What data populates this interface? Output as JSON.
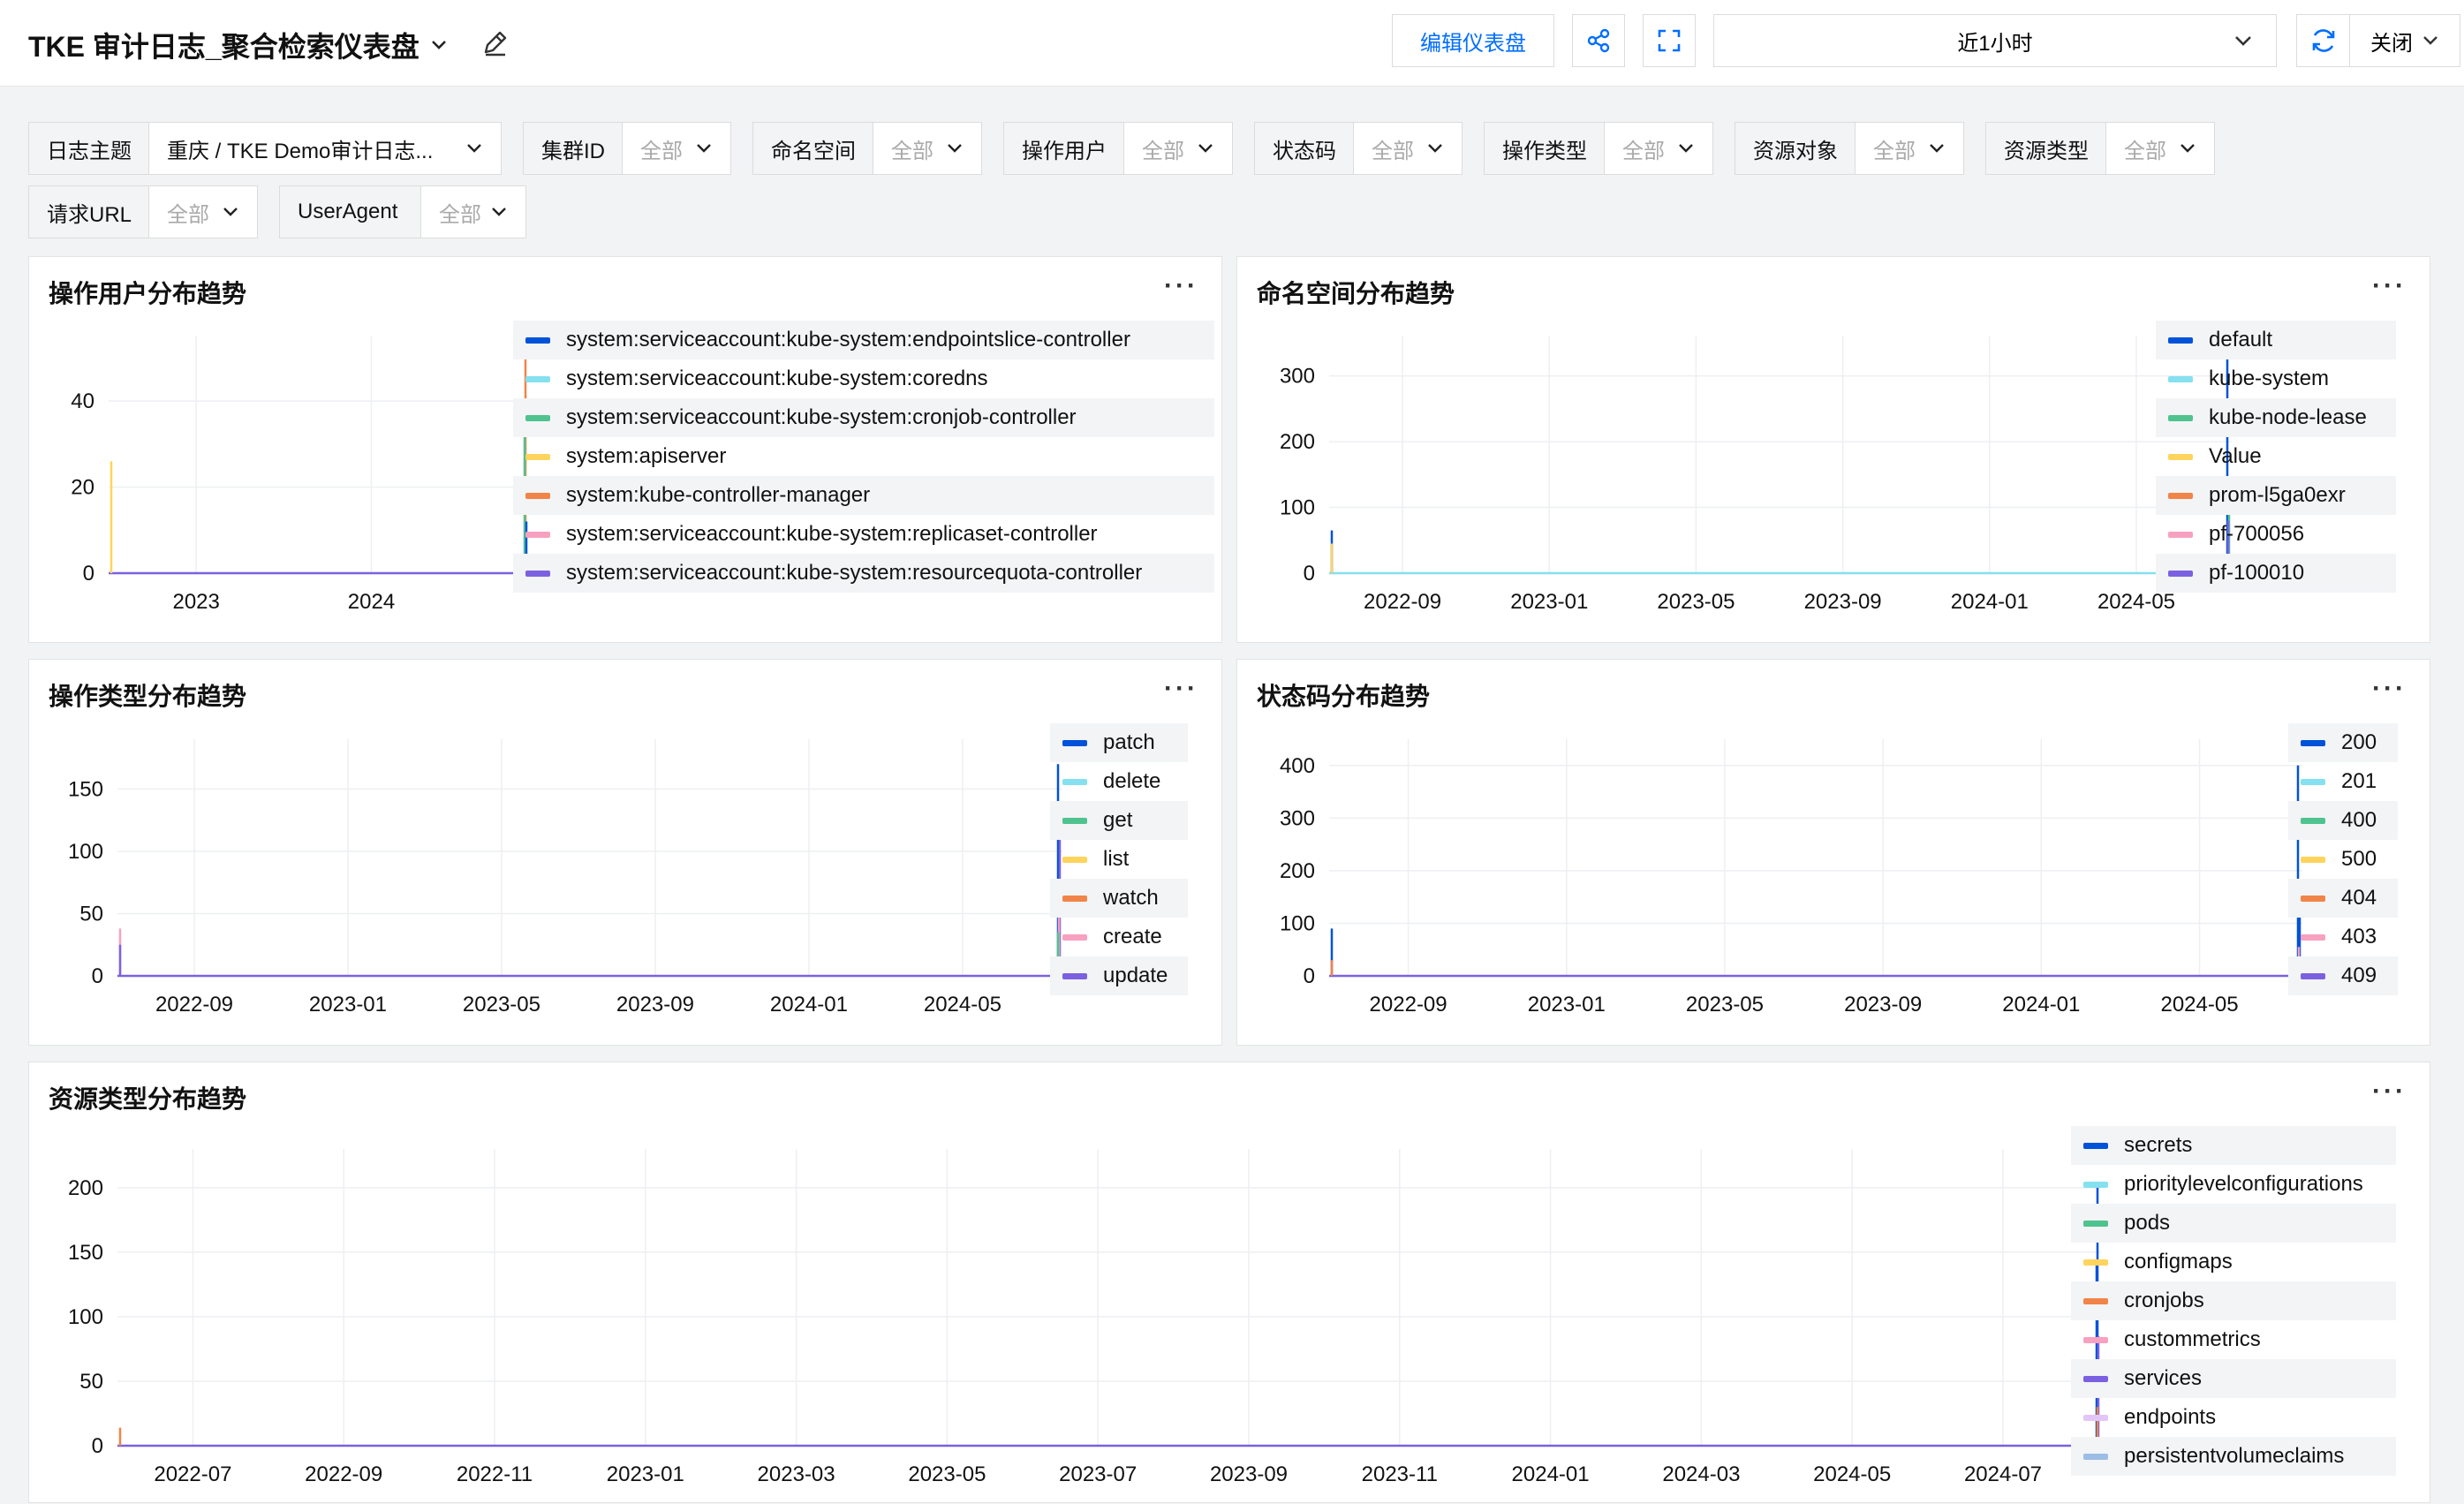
{
  "header": {
    "title": "TKE 审计日志_聚合检索仪表盘",
    "edit_button": "编辑仪表盘",
    "time_range": "近1小时",
    "close_label": "关闭"
  },
  "filters": [
    {
      "label": "日志主题",
      "value": "重庆 / TKE Demo审计日志..."
    },
    {
      "label": "集群ID",
      "value": "全部"
    },
    {
      "label": "命名空间",
      "value": "全部"
    },
    {
      "label": "操作用户",
      "value": "全部"
    },
    {
      "label": "状态码",
      "value": "全部"
    },
    {
      "label": "操作类型",
      "value": "全部"
    },
    {
      "label": "资源对象",
      "value": "全部"
    },
    {
      "label": "资源类型",
      "value": "全部"
    },
    {
      "label": "请求URL",
      "value": "全部"
    },
    {
      "label": "UserAgent",
      "value": "全部"
    }
  ],
  "colors": [
    "#0052d9",
    "#85e0f0",
    "#4fc38f",
    "#ffd45c",
    "#f18448",
    "#f8a0c0",
    "#7b61e0",
    "#e3c6f7",
    "#9bbde6"
  ],
  "panels": [
    {
      "title": "操作用户分布趋势",
      "more": "···",
      "chart_data": {
        "type": "line",
        "x_ticks": [
          "2023",
          "2024"
        ],
        "y_ticks": [
          0,
          20,
          40
        ],
        "ylim": [
          0,
          55
        ],
        "legend": [
          "system:serviceaccount:kube-system:endpointslice-controller",
          "system:serviceaccount:kube-system:coredns",
          "system:serviceaccount:kube-system:cronjob-controller",
          "system:apiserver",
          "system:kube-controller-manager",
          "system:serviceaccount:kube-system:replicaset-controller",
          "system:serviceaccount:kube-system:resourcequota-controller"
        ],
        "spikes": [
          {
            "x": 0.0,
            "y": 26,
            "c": 3
          },
          {
            "x": 1.0,
            "y": 52,
            "c": 4
          },
          {
            "x": 1.0,
            "y": 32,
            "c": 2
          },
          {
            "x": 1.0,
            "y": 12,
            "c": 0
          }
        ]
      }
    },
    {
      "title": "命名空间分布趋势",
      "more": "···",
      "chart_data": {
        "type": "line",
        "x_ticks": [
          "2022-09",
          "2023-01",
          "2023-05",
          "2023-09",
          "2024-01",
          "2024-05"
        ],
        "y_ticks": [
          0,
          100,
          200,
          300
        ],
        "ylim": [
          0,
          360
        ],
        "legend": [
          "default",
          "kube-system",
          "kube-node-lease",
          "Value",
          "prom-l5ga0exr",
          "pf-700056",
          "pf-100010"
        ],
        "spikes": [
          {
            "x": 0.0,
            "y": 65,
            "c": 0
          },
          {
            "x": 0.0,
            "y": 45,
            "c": 3
          },
          {
            "x": 1.0,
            "y": 325,
            "c": 0
          },
          {
            "x": 1.0,
            "y": 145,
            "c": 2
          },
          {
            "x": 1.0,
            "y": 80,
            "c": 6
          }
        ]
      }
    },
    {
      "title": "操作类型分布趋势",
      "more": "···",
      "chart_data": {
        "type": "line",
        "x_ticks": [
          "2022-09",
          "2023-01",
          "2023-05",
          "2023-09",
          "2024-01",
          "2024-05"
        ],
        "y_ticks": [
          0,
          50,
          100,
          150
        ],
        "ylim": [
          0,
          190
        ],
        "legend": [
          "patch",
          "delete",
          "get",
          "list",
          "watch",
          "create",
          "update"
        ],
        "spikes": [
          {
            "x": 0.0,
            "y": 38,
            "c": 5
          },
          {
            "x": 0.0,
            "y": 25,
            "c": 6
          },
          {
            "x": 1.0,
            "y": 170,
            "c": 0
          },
          {
            "x": 1.0,
            "y": 140,
            "c": 6
          },
          {
            "x": 1.0,
            "y": 75,
            "c": 5
          },
          {
            "x": 1.0,
            "y": 35,
            "c": 2
          }
        ]
      }
    },
    {
      "title": "状态码分布趋势",
      "more": "···",
      "chart_data": {
        "type": "line",
        "x_ticks": [
          "2022-09",
          "2023-01",
          "2023-05",
          "2023-09",
          "2024-01",
          "2024-05"
        ],
        "y_ticks": [
          0,
          100,
          200,
          300,
          400
        ],
        "ylim": [
          0,
          450
        ],
        "legend": [
          "200",
          "201",
          "400",
          "500",
          "404",
          "403",
          "409"
        ],
        "spikes": [
          {
            "x": 0.0,
            "y": 90,
            "c": 0
          },
          {
            "x": 0.0,
            "y": 30,
            "c": 4
          },
          {
            "x": 1.0,
            "y": 400,
            "c": 0
          },
          {
            "x": 1.0,
            "y": 145,
            "c": 0
          },
          {
            "x": 1.0,
            "y": 55,
            "c": 5
          }
        ]
      }
    },
    {
      "title": "资源类型分布趋势",
      "more": "···",
      "chart_data": {
        "type": "line",
        "x_ticks": [
          "2022-07",
          "2022-09",
          "2022-11",
          "2023-01",
          "2023-03",
          "2023-05",
          "2023-07",
          "2023-09",
          "2023-11",
          "2024-01",
          "2024-03",
          "2024-05",
          "2024-07"
        ],
        "y_ticks": [
          0,
          50,
          100,
          150,
          200
        ],
        "ylim": [
          0,
          230
        ],
        "legend": [
          "secrets",
          "prioritylevelconfigurations",
          "pods",
          "configmaps",
          "cronjobs",
          "custommetrics",
          "services",
          "endpoints",
          "persistentvolumeclaims"
        ],
        "spikes": [
          {
            "x": 0.0,
            "y": 14,
            "c": 4
          },
          {
            "x": 1.0,
            "y": 200,
            "c": 0
          },
          {
            "x": 1.0,
            "y": 143,
            "c": 0
          },
          {
            "x": 1.0,
            "y": 85,
            "c": 6
          },
          {
            "x": 1.0,
            "y": 30,
            "c": 4
          }
        ]
      }
    }
  ]
}
